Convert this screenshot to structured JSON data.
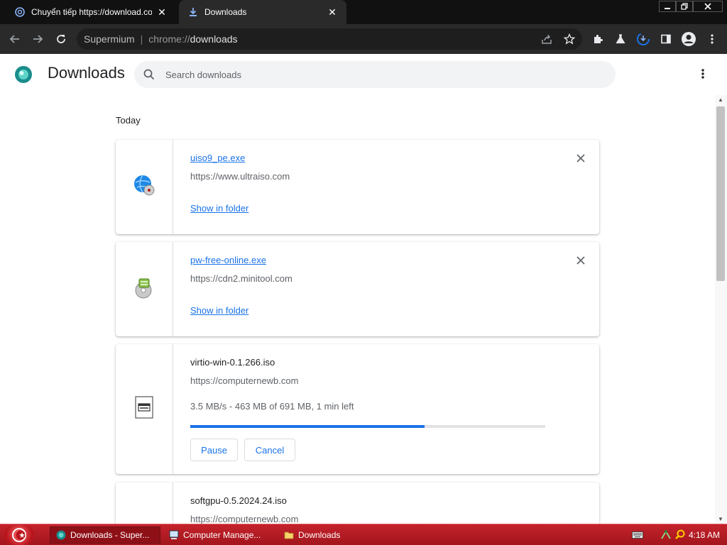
{
  "browser": {
    "tabs": [
      {
        "title": "Chuyển tiếp https://download.com",
        "favicon": "redirect-icon",
        "active": false
      },
      {
        "title": "Downloads",
        "favicon": "download-icon",
        "active": true
      }
    ],
    "omnibox": {
      "label": "Supermium",
      "url_scheme": "chrome://",
      "url_path": "downloads"
    }
  },
  "page": {
    "title": "Downloads",
    "search_placeholder": "Search downloads",
    "section_label": "Today"
  },
  "downloads": [
    {
      "name": "uiso9_pe.exe",
      "source": "https://www.ultraiso.com",
      "action": "Show in folder",
      "state": "complete",
      "icon": "globe-cd-icon"
    },
    {
      "name": "pw-free-online.exe",
      "source": "https://cdn2.minitool.com",
      "action": "Show in folder",
      "state": "complete",
      "icon": "installer-disk-icon"
    },
    {
      "name": "virtio-win-0.1.266.iso",
      "source": "https://computernewb.com",
      "status": "3.5 MB/s - 463 MB of 691 MB, 1 min left",
      "progress": 0.66,
      "pause_label": "Pause",
      "cancel_label": "Cancel",
      "state": "in-progress",
      "icon": "iso-file-icon"
    },
    {
      "name": "softgpu-0.5.2024.24.iso",
      "source": "https://computernewb.com",
      "state": "partial",
      "icon": "iso-file-icon"
    }
  ],
  "taskbar": {
    "tasks": [
      {
        "label": "Downloads - Super...",
        "icon": "browser-icon"
      },
      {
        "label": "Computer Manage...",
        "icon": "computer-management-icon"
      },
      {
        "label": "Downloads",
        "icon": "folder-icon"
      }
    ],
    "clock": "4:18 AM"
  },
  "colors": {
    "accent": "#1a73e8",
    "taskbar": "#c4232c",
    "chrome_dark": "#2a2a2a"
  }
}
